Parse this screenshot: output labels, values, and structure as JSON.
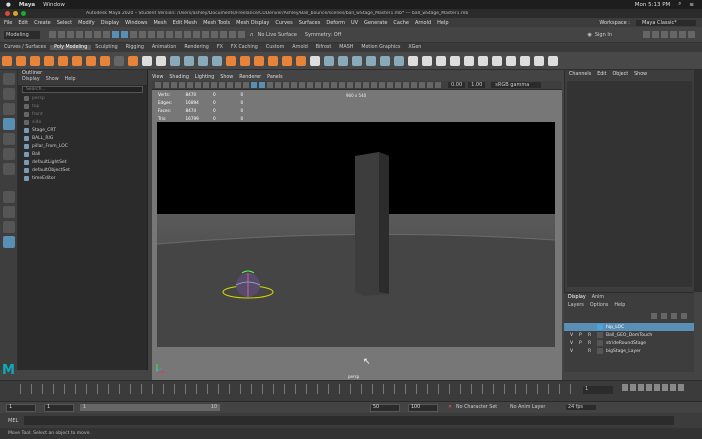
{
  "mac_menu": {
    "app": "Maya",
    "window": "Window",
    "status_time": "Mon 5:13 PM"
  },
  "window_title": "Autodesk Maya 2020 – Student Version: /Users/ashley/Documents/Freelance/CUDenver/Ashley/Ball_bounce/scenes/ball_wStage_Master1.mb* --- ball_wStage_Master1.mb",
  "workspace": {
    "label": "Workspace :",
    "value": "Maya Classic*"
  },
  "main_menu": [
    "File",
    "Edit",
    "Create",
    "Select",
    "Modify",
    "Display",
    "Windows",
    "Mesh",
    "Edit Mesh",
    "Mesh Tools",
    "Mesh Display",
    "Curves",
    "Surfaces",
    "Deform",
    "UV",
    "Generate",
    "Cache",
    "Arnold",
    "Help"
  ],
  "status_line": {
    "mode": "Modeling",
    "live_surface": "No Live Surface",
    "symmetry": "Symmetry: Off",
    "sign_in": "Sign In"
  },
  "shelf_tabs": [
    "Curves / Surfaces",
    "Poly Modeling",
    "Sculpting",
    "Rigging",
    "Animation",
    "Rendering",
    "FX",
    "FX Caching",
    "Custom",
    "Arnold",
    "Bifrost",
    "MASH",
    "Motion Graphics",
    "XGen"
  ],
  "shelf_active": "Poly Modeling",
  "outliner": {
    "title": "Outliner",
    "menu": [
      "Display",
      "Show",
      "Help"
    ],
    "search_placeholder": "Search...",
    "items": [
      {
        "name": "persp",
        "dim": true
      },
      {
        "name": "top",
        "dim": true
      },
      {
        "name": "front",
        "dim": true
      },
      {
        "name": "side",
        "dim": true
      },
      {
        "name": "Stage_CRT",
        "dim": false
      },
      {
        "name": "BALL_RIG",
        "dim": false
      },
      {
        "name": "pillar_From_LOC",
        "dim": false
      },
      {
        "name": "Ball",
        "dim": false
      },
      {
        "name": "defaultLightSet",
        "dim": false
      },
      {
        "name": "defaultObjectSet",
        "dim": false
      },
      {
        "name": "timeEditor",
        "dim": false
      }
    ]
  },
  "viewport": {
    "menu": [
      "View",
      "Shading",
      "Lighting",
      "Show",
      "Renderer",
      "Panels"
    ],
    "exposure": "0.00",
    "gamma": "1.00",
    "color_space": "sRGB gamma",
    "resolution": "960 x 540",
    "camera": "persp",
    "hud": [
      {
        "label": "Verts:",
        "a": "8470",
        "b": "0",
        "c": "0"
      },
      {
        "label": "Edges:",
        "a": "16894",
        "b": "0",
        "c": "0"
      },
      {
        "label": "Faces:",
        "a": "8474",
        "b": "0",
        "c": "0"
      },
      {
        "label": "Tris:",
        "a": "16799",
        "b": "0",
        "c": "0"
      },
      {
        "label": "UVs:",
        "a": "9916",
        "b": "0",
        "c": "0"
      }
    ]
  },
  "channel_box": {
    "tabs": [
      "Channels",
      "Edit",
      "Object",
      "Show"
    ]
  },
  "layer_editor": {
    "tabs": [
      "Display",
      "Anim"
    ],
    "menu": [
      "Layers",
      "Options",
      "Help"
    ],
    "layers": [
      {
        "v": "",
        "p": "",
        "r": "",
        "name": "hip_LOC",
        "color": "#4aa3df",
        "selected": true
      },
      {
        "v": "V",
        "p": "P",
        "r": "R",
        "name": "Ball_GEO_DomTouch",
        "color": "#555555",
        "selected": false
      },
      {
        "v": "V",
        "p": "P",
        "r": "R",
        "name": "strideRoundStage",
        "color": "#555555",
        "selected": false
      },
      {
        "v": "V",
        "p": "",
        "r": "R",
        "name": "bigStage_Layer",
        "color": "#555555",
        "selected": false
      }
    ]
  },
  "range": {
    "start": "1",
    "current_start": "1",
    "range_field": "1",
    "range_end": "10",
    "end": "50",
    "end_max": "100"
  },
  "timeline": {
    "current_frame": "1"
  },
  "status_right": {
    "character_set": "No Character Set",
    "anim_layer": "No Anim Layer",
    "fps": "24 fps"
  },
  "mel_label": "MEL",
  "help_line": "Move Tool: Select an object to move."
}
